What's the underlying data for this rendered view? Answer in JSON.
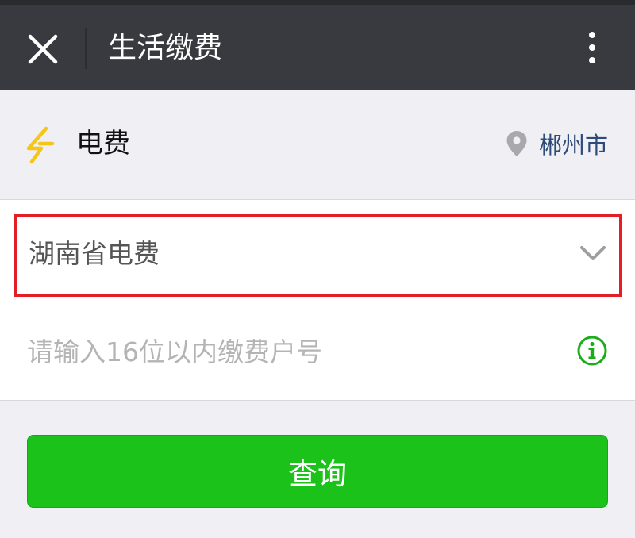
{
  "header": {
    "title": "生活缴费",
    "close_icon": "close-icon",
    "more_icon": "more-vertical-icon"
  },
  "section": {
    "title": "电费",
    "icon": "lightning-icon",
    "location": "郴州市",
    "location_icon": "map-pin-icon"
  },
  "form": {
    "provider_value": "湖南省电费",
    "provider_icon": "chevron-down-icon",
    "account_placeholder": "请输入16位以内缴费户号",
    "account_value": "",
    "info_icon": "info-icon"
  },
  "actions": {
    "query_label": "查询"
  },
  "colors": {
    "topbar": "#393a3f",
    "accent_green": "#1ac21a",
    "highlight_border": "#e31e26",
    "location_text": "#2d4a78",
    "lightning": "#f5c518"
  }
}
